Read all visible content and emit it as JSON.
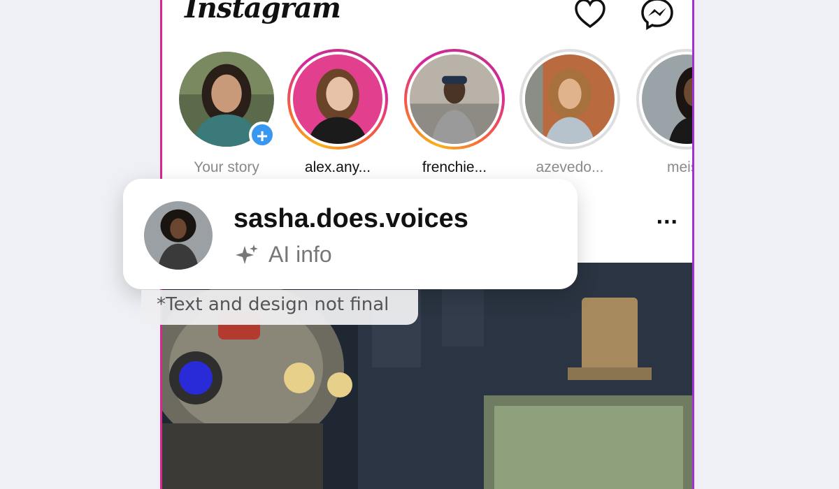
{
  "app": {
    "title": "Instagram"
  },
  "header": {
    "notifications_icon": "heart-icon",
    "messages_icon": "messenger-icon"
  },
  "stories": [
    {
      "label": "Your story",
      "state": "own"
    },
    {
      "label": "alex.any...",
      "state": "unseen"
    },
    {
      "label": "frenchie...",
      "state": "unseen"
    },
    {
      "label": "azevedo...",
      "state": "seen"
    },
    {
      "label": "meish",
      "state": "seen"
    }
  ],
  "post": {
    "more_label": "..."
  },
  "popup": {
    "username": "sasha.does.voices",
    "ai_label": "AI info",
    "ai_icon": "sparkle-icon"
  },
  "note": "*Text and design not final",
  "colors": {
    "accent_blue": "#3897f0",
    "ring_pink": "#d6249f",
    "ring_orange": "#f9b21a"
  }
}
